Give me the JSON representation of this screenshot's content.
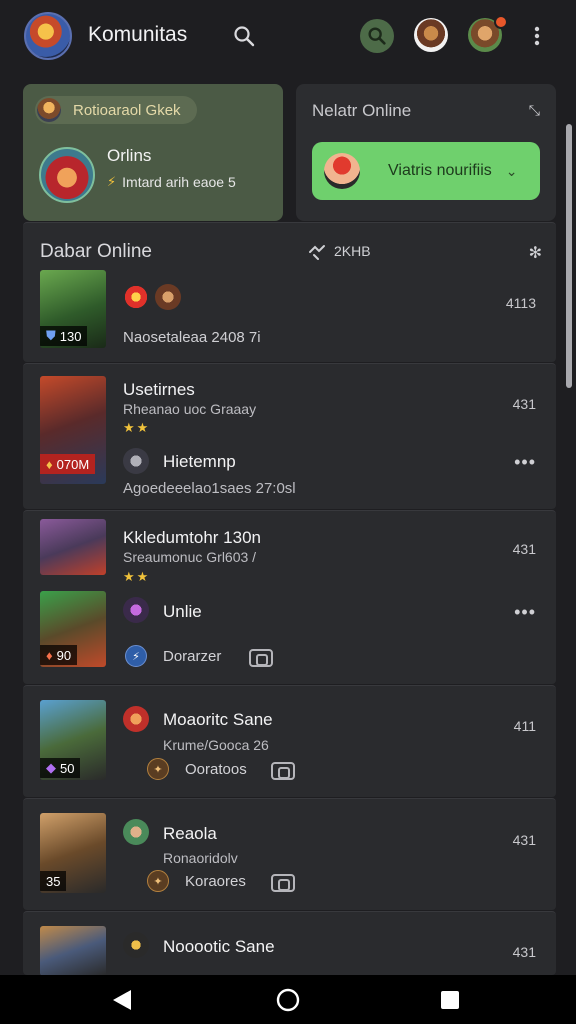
{
  "header": {
    "title": "Komunitas"
  },
  "featured": {
    "chip_label": "Rotioaraol Gkek",
    "title": "Orlins",
    "subtitle": "Imtard arih eaoe 5"
  },
  "online_panel": {
    "title": "Nelatr Online",
    "button_label": "Viatris nourifiis"
  },
  "section": {
    "title": "Dabar Online",
    "count_label": "2KHB",
    "first_row": {
      "thumb_badge": "130",
      "subtitle": "Naosetaleaa 2408 7i",
      "count": "4113"
    }
  },
  "groups": [
    {
      "title": "Usetirnes",
      "subtitle": "Rheanao uoc Graaay",
      "count": "431",
      "thumb_badge": "070M",
      "sub_title": "Hietemnp",
      "sub_subtitle": "Agoedeeelao1saes 27:0sl"
    },
    {
      "title": "Kkledumtohr 130n",
      "subtitle": "Sreaumonuc Grl603 /",
      "count": "431",
      "thumb_badge": "90",
      "sub_title": "Unlie",
      "tag": "Dorarzer"
    },
    {
      "title": "Moaoritc Sane",
      "subtitle": "Krume/Gooca 26",
      "count": "411",
      "thumb_badge": "50",
      "tag": "Ooratoos"
    },
    {
      "title": "Reaola",
      "subtitle": "Ronaoridolv",
      "count": "431",
      "thumb_badge": "35",
      "tag": "Koraores"
    },
    {
      "title": "Nooootic Sane",
      "count": "431"
    }
  ],
  "colors": {
    "accent_green": "#6fd06d",
    "feature_bg": "#4b5a45",
    "star": "#f0c23b",
    "notification": "#e8572a"
  }
}
